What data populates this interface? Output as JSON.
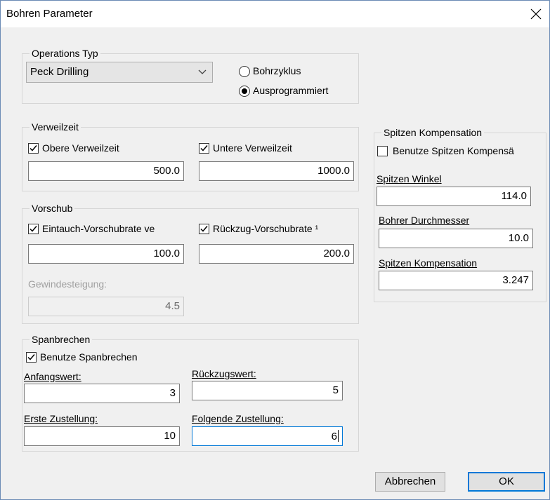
{
  "window": {
    "title": "Bohren Parameter"
  },
  "operations": {
    "legend": "Operations Typ",
    "combo_value": "Peck Drilling",
    "radio_options": [
      {
        "label": "Bohrzyklus",
        "selected": false
      },
      {
        "label": "Ausprogrammiert",
        "selected": true
      }
    ]
  },
  "verweilzeit": {
    "legend": "Verweilzeit",
    "obere": {
      "label": "Obere Verweilzeit",
      "checked": true,
      "value": "500.0"
    },
    "untere": {
      "label": "Untere Verweilzeit",
      "checked": true,
      "value": "1000.0"
    }
  },
  "vorschub": {
    "legend": "Vorschub",
    "eintauch": {
      "label": "Eintauch-Vorschubrate ve",
      "checked": true,
      "value": "100.0"
    },
    "rueckzug": {
      "label": "Rückzug-Vorschubrate ¹",
      "checked": true,
      "value": "200.0"
    },
    "gewinde": {
      "label": "Gewindesteigung:",
      "value": "4.5"
    }
  },
  "spanbrechen": {
    "legend": "Spanbrechen",
    "benutze": {
      "label": "Benutze Spanbrechen",
      "checked": true
    },
    "anfangswert": {
      "label": "Anfangswert:",
      "value": "3"
    },
    "rueckzugswert": {
      "label": "Rückzugswert:",
      "value": "5"
    },
    "erste": {
      "label": "Erste Zustellung:",
      "value": "10"
    },
    "folgende": {
      "label": "Folgende Zustellung:",
      "value": "6"
    }
  },
  "spitzen": {
    "legend": "Spitzen Kompensation",
    "benutze": {
      "label": "Benutze Spitzen Kompensä",
      "checked": false
    },
    "winkel": {
      "label": "Spitzen Winkel",
      "value": "114.0"
    },
    "durchmesser": {
      "label": "Bohrer Durchmesser",
      "value": "10.0"
    },
    "kompensation": {
      "label": "Spitzen Kompensation",
      "value": "3.247"
    }
  },
  "buttons": {
    "cancel": "Abbrechen",
    "ok": "OK"
  },
  "icons": {
    "close": "close-icon",
    "check": "checkmark-icon",
    "dropdown": "chevron-down-icon"
  }
}
